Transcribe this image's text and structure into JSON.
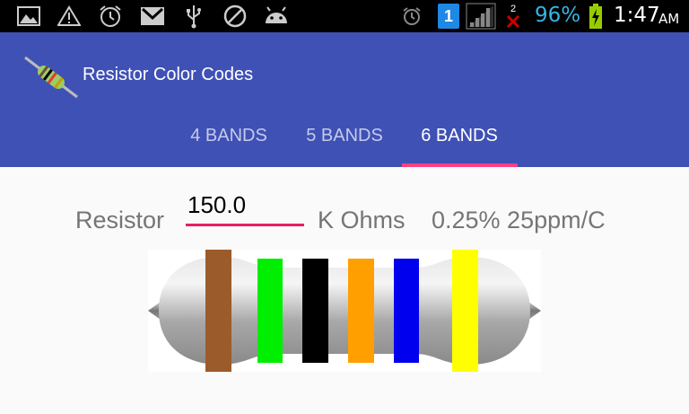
{
  "status": {
    "battery_percent": "96%",
    "time": "1:47",
    "ampm": "AM",
    "sim_number": "1",
    "missed_count": "2",
    "colors": {
      "bar": "#000000",
      "battery_text": "#33b5e5",
      "battery_icon": "#99cc00",
      "x_mark": "#cc0000"
    }
  },
  "app": {
    "title": "Resistor Color Codes",
    "primary_color": "#3f51b5",
    "accent_color": "#ff4081",
    "tabs": [
      {
        "label": "4 BANDS",
        "active": false
      },
      {
        "label": "5 BANDS",
        "active": false
      },
      {
        "label": "6 BANDS",
        "active": true
      }
    ]
  },
  "main": {
    "resistor_label": "Resistor",
    "value_input": "150.0",
    "unit_label": "K Ohms",
    "tolerance_label": "0.25% 25ppm/C",
    "bands": [
      {
        "name": "brown",
        "color": "#9c5b2a"
      },
      {
        "name": "green",
        "color": "#00ee00"
      },
      {
        "name": "black",
        "color": "#000000"
      },
      {
        "name": "orange",
        "color": "#ffa000"
      },
      {
        "name": "blue",
        "color": "#0000ee"
      },
      {
        "name": "yellow",
        "color": "#ffff00"
      }
    ]
  }
}
